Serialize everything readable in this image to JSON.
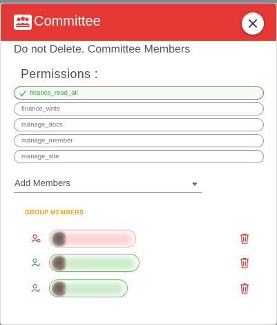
{
  "dialog": {
    "title": "Committee",
    "subtitle": "Do not Delete. Committee Members",
    "close_icon": "close-icon",
    "header_color": "#e53935"
  },
  "permissions": {
    "heading": "Permissions  :",
    "items": [
      {
        "label": "finance_read_all",
        "selected": true
      },
      {
        "label": "finance_write",
        "selected": false
      },
      {
        "label": "manage_docs",
        "selected": false
      },
      {
        "label": "manage_member",
        "selected": false
      },
      {
        "label": "manage_site",
        "selected": false
      }
    ]
  },
  "add_members": {
    "placeholder": "Add Members"
  },
  "group_members": {
    "heading": "GROUP MEMBERS",
    "members": [
      {
        "role_icon": "user-admin-icon",
        "status": "red",
        "delete_icon": "trash-icon"
      },
      {
        "role_icon": "user-check-icon",
        "status": "green",
        "delete_icon": "trash-icon"
      },
      {
        "role_icon": "user-check-icon",
        "status": "green",
        "delete_icon": "trash-icon"
      }
    ]
  },
  "colors": {
    "accent_red": "#e53935",
    "selected_green": "#43a047",
    "group_label": "#f0a020"
  }
}
